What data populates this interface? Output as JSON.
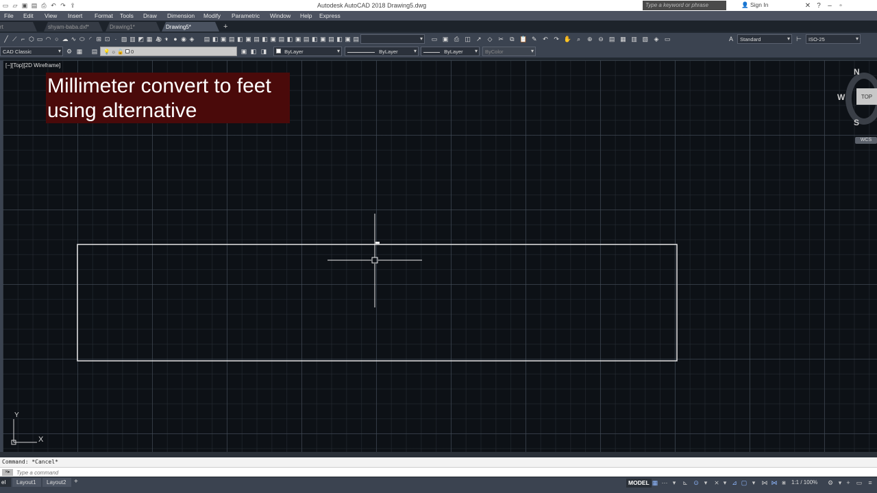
{
  "app": {
    "title": "Autodesk AutoCAD 2018    Drawing5.dwg",
    "search_placeholder": "Type a keyword or phrase",
    "sign_in": "Sign In"
  },
  "menu": [
    "File",
    "Edit",
    "View",
    "Insert",
    "Format",
    "Tools",
    "Draw",
    "Dimension",
    "Modify",
    "Parametric",
    "Window",
    "Help",
    "Express"
  ],
  "tabs": [
    {
      "label": "rt",
      "active": false
    },
    {
      "label": "shyam-baba.dxf*",
      "active": false
    },
    {
      "label": "Drawing1*",
      "active": false
    },
    {
      "label": "Drawing5*",
      "active": true
    }
  ],
  "toolbar": {
    "workspace": "CAD Classic",
    "layer": "0",
    "color": "ByLayer",
    "linetype": "ByLayer",
    "lineweight": "ByLayer",
    "plotstyle": "ByColor",
    "text_style": "Standard",
    "dim_style": "ISO-25"
  },
  "viewport": {
    "label": "[−][Top][2D Wireframe]"
  },
  "caption": {
    "line1": "Millimeter convert to feet",
    "line2": "using alternative"
  },
  "viewcube": {
    "north": "N",
    "south": "S",
    "west": "W",
    "face": "TOP",
    "wcs": "WCS"
  },
  "ucs": {
    "x": "X",
    "y": "Y"
  },
  "command": {
    "history": "Command: *Cancel*",
    "placeholder": "Type a command",
    "icon": "×▸"
  },
  "status": {
    "layout_tabs": [
      {
        "label": "el",
        "active": true
      },
      {
        "label": "Layout1",
        "active": false
      },
      {
        "label": "Layout2",
        "active": false
      }
    ],
    "model": "MODEL",
    "scale": "1:1 / 100%"
  }
}
